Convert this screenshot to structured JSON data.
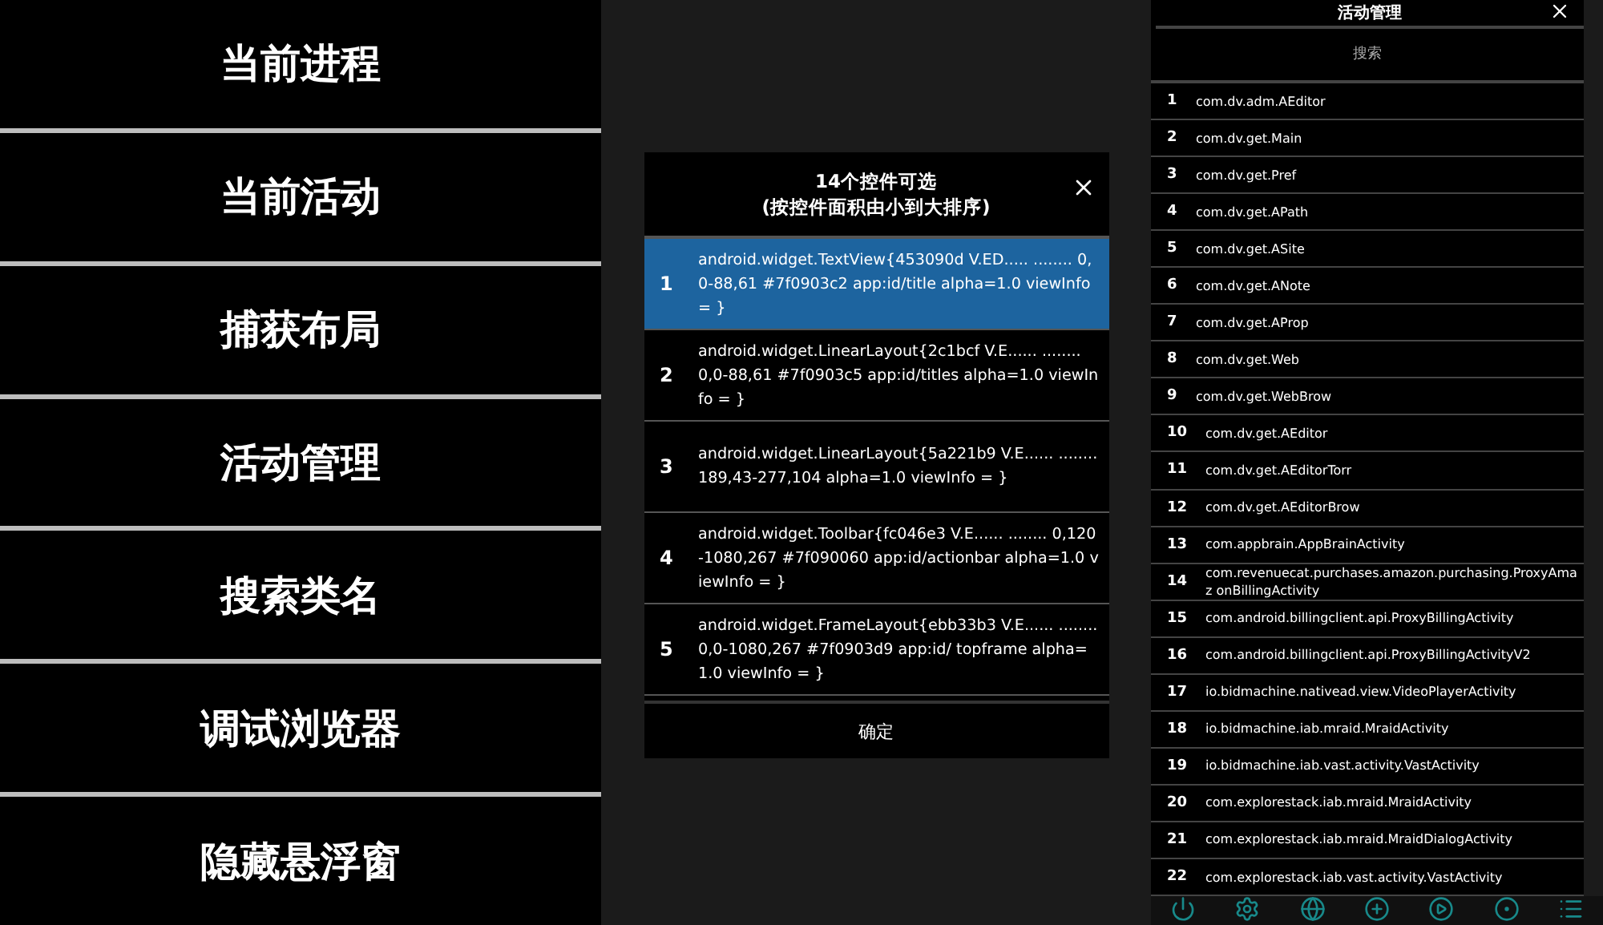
{
  "menu": [
    {
      "label": "当前进程"
    },
    {
      "label": "当前活动"
    },
    {
      "label": "捕获布局"
    },
    {
      "label": "活动管理"
    },
    {
      "label": "搜索类名"
    },
    {
      "label": "调试浏览器"
    },
    {
      "label": "隐藏悬浮窗"
    }
  ],
  "dialog": {
    "title": "14个控件可选",
    "subtitle": "(按控件面积由小到大排序)",
    "confirm": "确定",
    "items": [
      {
        "index": "1",
        "text": "android.widget.TextView{453090d V.ED..... ........ 0,0-88,61 #7f0903c2 app:id/title alpha=1.0 viewInfo = }",
        "selected": true
      },
      {
        "index": "2",
        "text": "android.widget.LinearLayout{2c1bcf V.E...... ........ 0,0-88,61 #7f0903c5 app:id/titles alpha=1.0 viewInfo = }",
        "selected": false
      },
      {
        "index": "3",
        "text": "android.widget.LinearLayout{5a221b9 V.E...... ........ 189,43-277,104 alpha=1.0 viewInfo = }",
        "selected": false
      },
      {
        "index": "4",
        "text": "android.widget.Toolbar{fc046e3 V.E...... ........ 0,120-1080,267 #7f090060 app:id/actionbar alpha=1.0 viewInfo = }",
        "selected": false
      },
      {
        "index": "5",
        "text": "android.widget.FrameLayout{ebb33b3 V.E...... ........ 0,0-1080,267 #7f0903d9 app:id/ topframe alpha=1.0 viewInfo = }",
        "selected": false
      }
    ]
  },
  "activity_panel": {
    "title": "活动管理",
    "search": {
      "placeholder": "搜索"
    },
    "rows": [
      {
        "index": "1",
        "name": "com.dv.adm.AEditor"
      },
      {
        "index": "2",
        "name": "com.dv.get.Main"
      },
      {
        "index": "3",
        "name": "com.dv.get.Pref"
      },
      {
        "index": "4",
        "name": "com.dv.get.APath"
      },
      {
        "index": "5",
        "name": "com.dv.get.ASite"
      },
      {
        "index": "6",
        "name": "com.dv.get.ANote"
      },
      {
        "index": "7",
        "name": "com.dv.get.AProp"
      },
      {
        "index": "8",
        "name": "com.dv.get.Web"
      },
      {
        "index": "9",
        "name": "com.dv.get.WebBrow"
      },
      {
        "index": "10",
        "name": "com.dv.get.AEditor"
      },
      {
        "index": "11",
        "name": "com.dv.get.AEditorTorr"
      },
      {
        "index": "12",
        "name": "com.dv.get.AEditorBrow"
      },
      {
        "index": "13",
        "name": "com.appbrain.AppBrainActivity"
      },
      {
        "index": "14",
        "name": "com.revenuecat.purchases.amazon.purchasing.ProxyAmaz onBillingActivity"
      },
      {
        "index": "15",
        "name": "com.android.billingclient.api.ProxyBillingActivity"
      },
      {
        "index": "16",
        "name": "com.android.billingclient.api.ProxyBillingActivityV2"
      },
      {
        "index": "17",
        "name": "io.bidmachine.nativead.view.VideoPlayerActivity"
      },
      {
        "index": "18",
        "name": "io.bidmachine.iab.mraid.MraidActivity"
      },
      {
        "index": "19",
        "name": "io.bidmachine.iab.vast.activity.VastActivity"
      },
      {
        "index": "20",
        "name": "com.explorestack.iab.mraid.MraidActivity"
      },
      {
        "index": "21",
        "name": "com.explorestack.iab.mraid.MraidDialogActivity"
      },
      {
        "index": "22",
        "name": "com.explorestack.iab.vast.activity.VastActivity"
      }
    ]
  }
}
